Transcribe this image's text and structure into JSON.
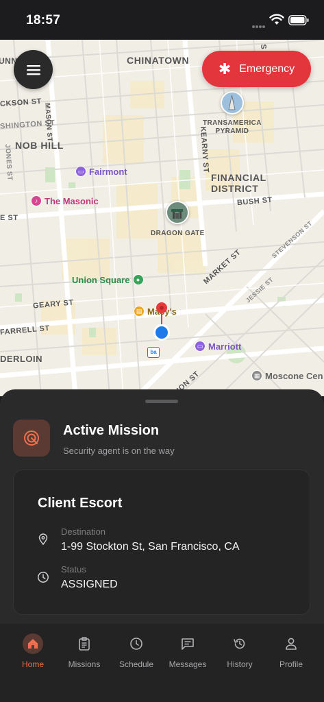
{
  "status_bar": {
    "time": "18:57"
  },
  "map": {
    "districts": [
      "CHINATOWN",
      "NOB HILL",
      "FINANCIAL\nDISTRICT"
    ],
    "streets": [
      "UNN",
      "CKSON ST",
      "SHINGTON ST",
      "MASON ST",
      "JONES ST",
      "KEARNY ST",
      "BUSH ST",
      "E ST",
      "GEARY ST",
      "FARRELL ST",
      "DERLOIN",
      "MARKET ST",
      "JESSIE ST",
      "STEVENSON ST",
      "ION ST",
      "S"
    ],
    "pois": {
      "fairmont": "Fairmont",
      "masonic": "The Masonic",
      "union_square": "Union Square",
      "macys": "Macy's",
      "marriott": "Marriott",
      "moscone": "Moscone Cen"
    },
    "landmarks": {
      "transamerica": "TRANSAMERICA\nPYRAMID",
      "dragon_gate": "DRAGON GATE"
    },
    "colors": {
      "emergency": "#e2353c",
      "accent": "#f0704e",
      "user_location": "#1e7ae8",
      "pin": "#e63a3a"
    }
  },
  "emergency_button": {
    "label": "Emergency"
  },
  "mission": {
    "title": "Active Mission",
    "subtitle": "Security agent is on the way",
    "card": {
      "title": "Client Escort",
      "destination_label": "Destination",
      "destination_value": "1-99 Stockton St, San Francisco, CA",
      "status_label": "Status",
      "status_value": "ASSIGNED"
    }
  },
  "tabs": [
    {
      "label": "Home",
      "icon": "home-icon",
      "active": true
    },
    {
      "label": "Missions",
      "icon": "clipboard-icon",
      "active": false
    },
    {
      "label": "Schedule",
      "icon": "clock-icon",
      "active": false
    },
    {
      "label": "Messages",
      "icon": "message-icon",
      "active": false
    },
    {
      "label": "History",
      "icon": "history-icon",
      "active": false
    },
    {
      "label": "Profile",
      "icon": "person-icon",
      "active": false
    }
  ]
}
